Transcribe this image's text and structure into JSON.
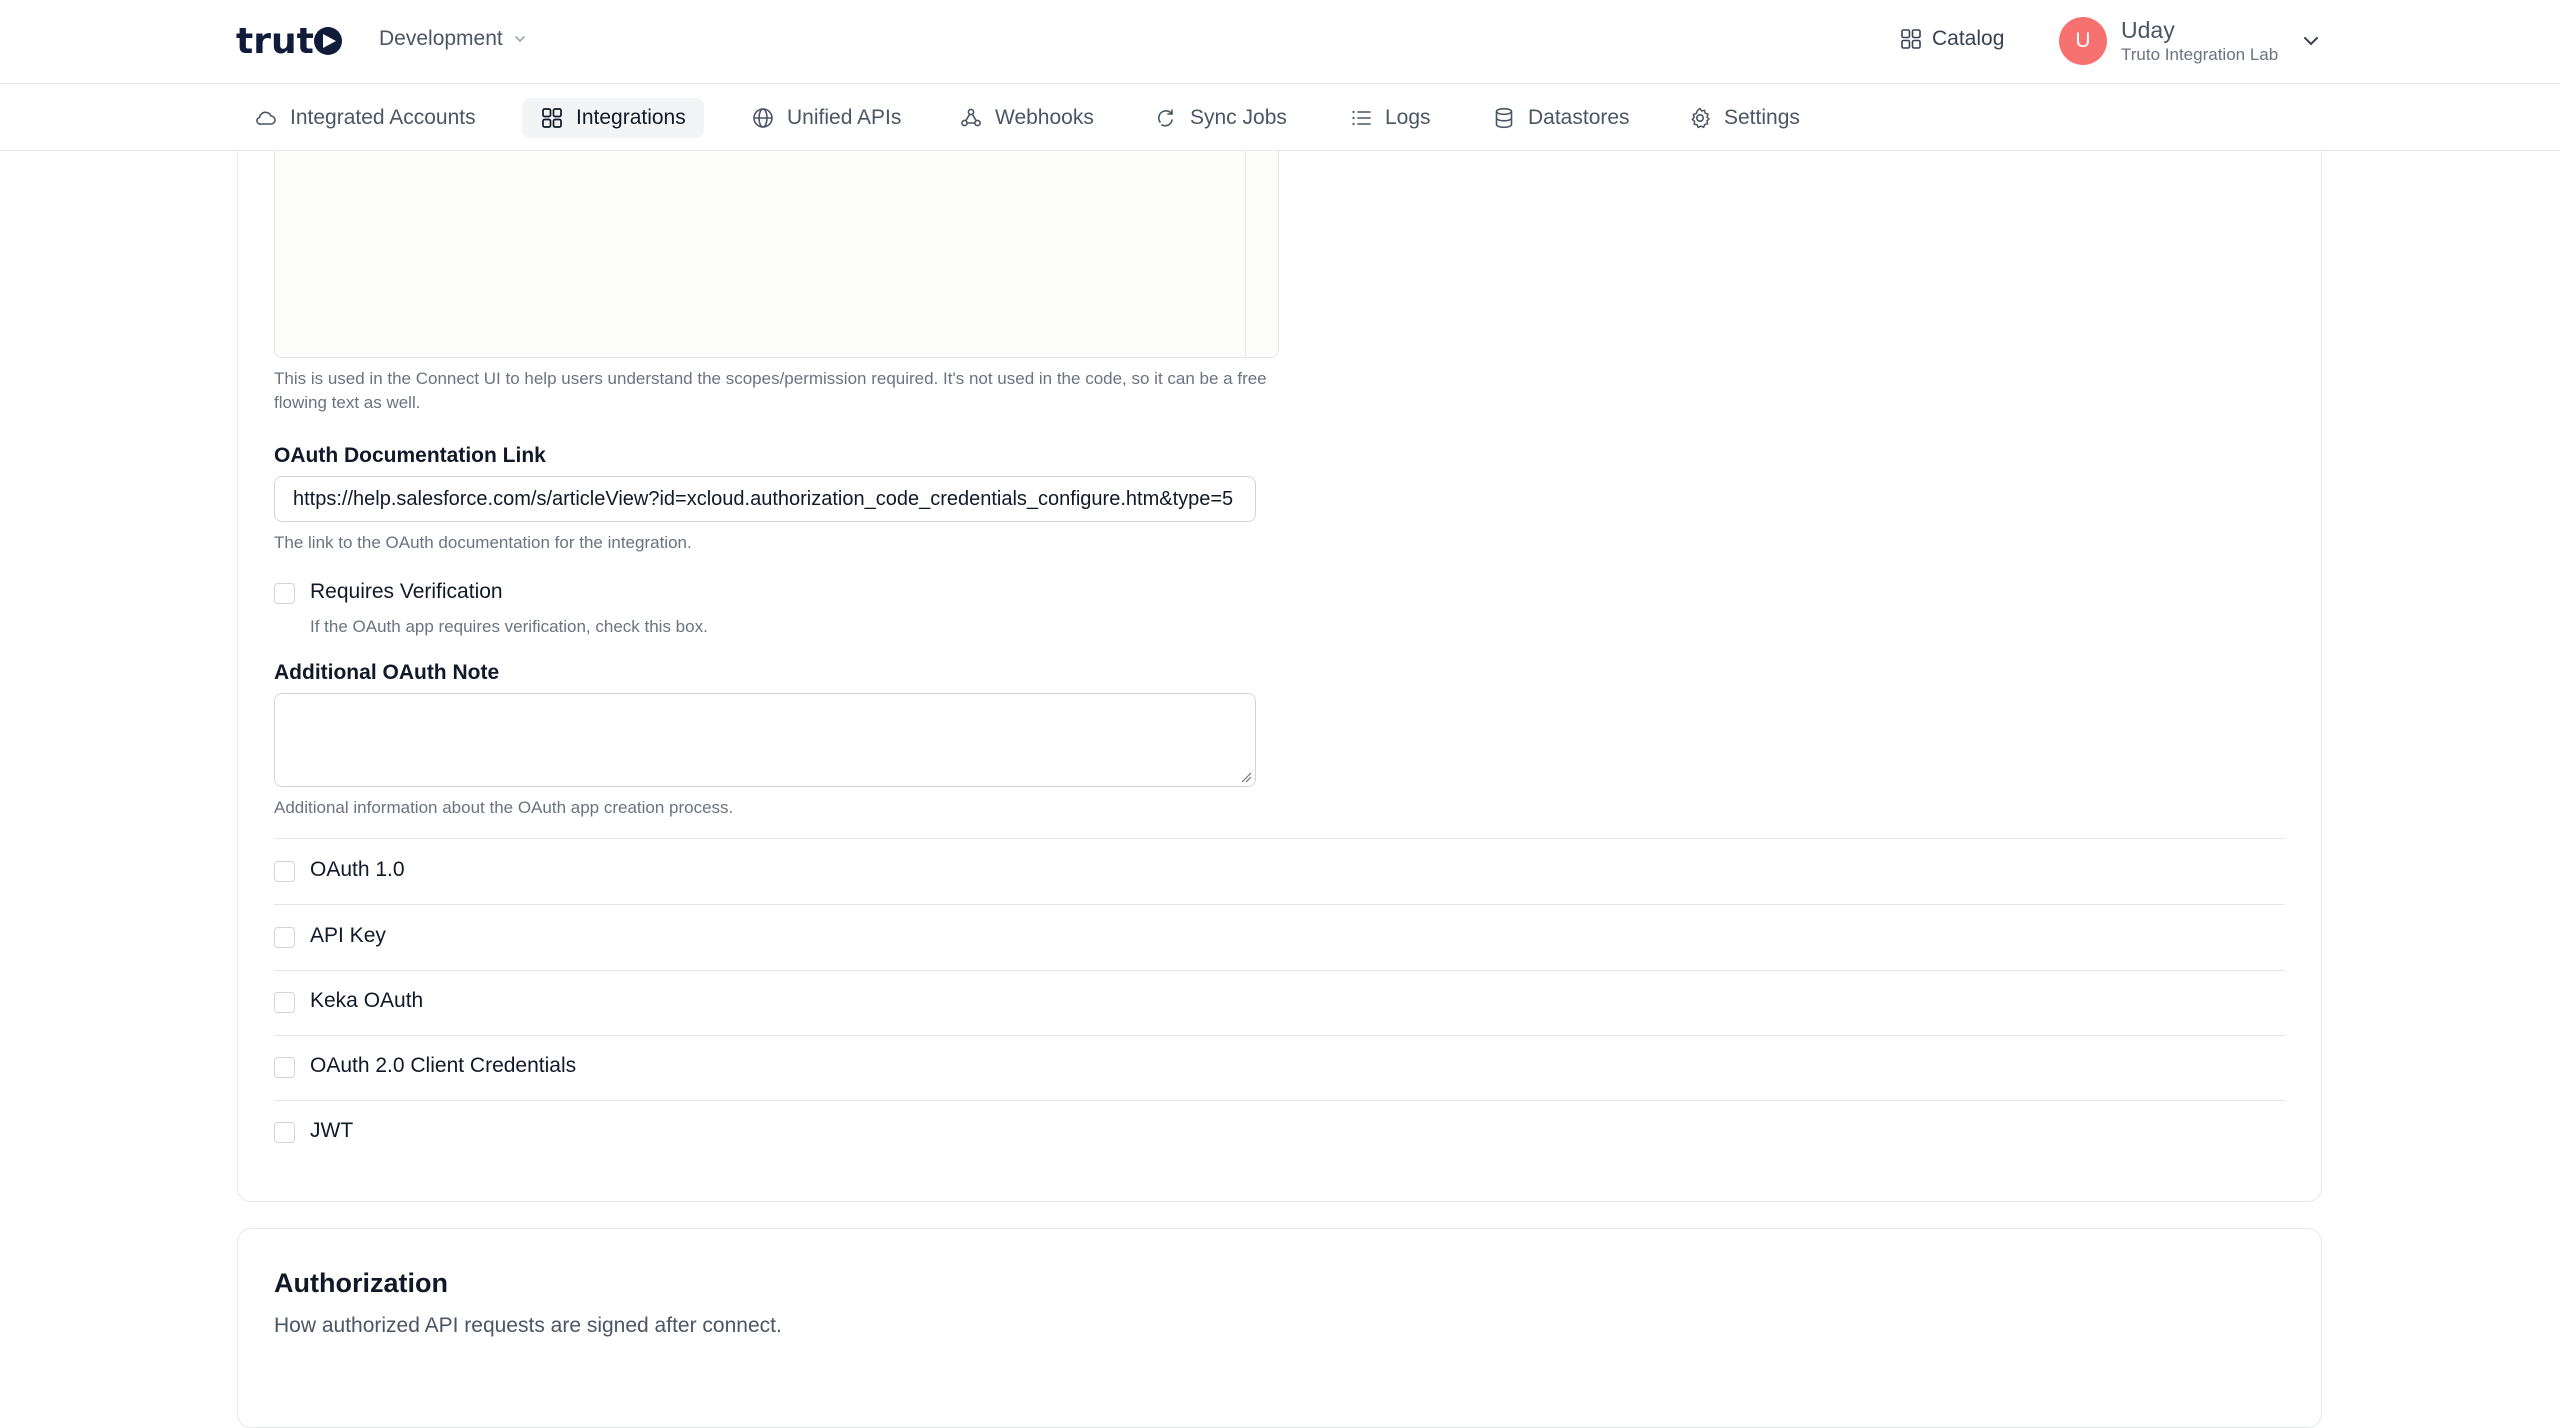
{
  "header": {
    "logo_text": "truto",
    "environment": "Development",
    "catalog_label": "Catalog",
    "user": {
      "initial": "U",
      "name": "Uday",
      "org": "Truto Integration Lab"
    }
  },
  "nav": {
    "items": [
      {
        "label": "Integrated Accounts",
        "icon": "cloud-icon"
      },
      {
        "label": "Integrations",
        "icon": "grid-icon",
        "active": true
      },
      {
        "label": "Unified APIs",
        "icon": "globe-icon"
      },
      {
        "label": "Webhooks",
        "icon": "webhook-icon"
      },
      {
        "label": "Sync Jobs",
        "icon": "sync-icon"
      },
      {
        "label": "Logs",
        "icon": "list-icon"
      },
      {
        "label": "Datastores",
        "icon": "database-icon"
      },
      {
        "label": "Settings",
        "icon": "gear-icon"
      }
    ]
  },
  "form": {
    "scopes_help": "This is used in the Connect UI to help users understand the scopes/permission required. It's not used in the code, so it can be a free flowing text as well.",
    "oauth_doc_label": "OAuth Documentation Link",
    "oauth_doc_value": "https://help.salesforce.com/s/articleView?id=xcloud.authorization_code_credentials_configure.htm&type=5",
    "oauth_doc_help": "The link to the OAuth documentation for the integration.",
    "requires_verification_label": "Requires Verification",
    "requires_verification_help": "If the OAuth app requires verification, check this box.",
    "additional_note_label": "Additional OAuth Note",
    "additional_note_value": "",
    "additional_note_help": "Additional information about the OAuth app creation process.",
    "auth_types": [
      {
        "label": "OAuth 1.0",
        "checked": false
      },
      {
        "label": "API Key",
        "checked": false
      },
      {
        "label": "Keka OAuth",
        "checked": false
      },
      {
        "label": "OAuth 2.0 Client Credentials",
        "checked": false
      },
      {
        "label": "JWT",
        "checked": false
      }
    ]
  },
  "authorization": {
    "title": "Authorization",
    "subtitle": "How authorized API requests are signed after connect."
  },
  "colors": {
    "avatar": "#f87171",
    "border": "#e5e7eb",
    "active_nav_bg": "#f3f4f6"
  }
}
